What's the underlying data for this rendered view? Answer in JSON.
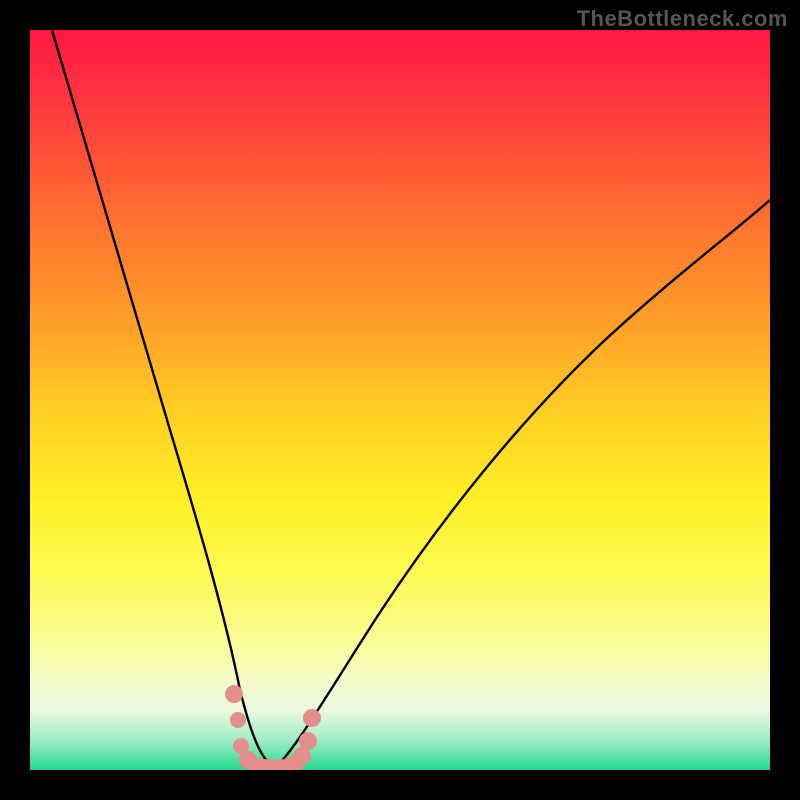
{
  "watermark": "TheBottleneck.com",
  "chart_data": {
    "type": "line",
    "title": "",
    "xlabel": "",
    "ylabel": "",
    "xlim": [
      0,
      100
    ],
    "ylim": [
      0,
      100
    ],
    "grid": false,
    "legend": false,
    "series": [
      {
        "name": "left-curve",
        "x": [
          3,
          6,
          10,
          14,
          18,
          22,
          25,
          27,
          28,
          29,
          30,
          31,
          32,
          33
        ],
        "y": [
          100,
          85,
          66,
          50,
          36,
          24,
          15,
          9,
          6,
          4,
          2.5,
          1.5,
          0.8,
          0.2
        ],
        "color": "#000000"
      },
      {
        "name": "right-curve",
        "x": [
          33,
          36,
          40,
          46,
          54,
          62,
          70,
          78,
          86,
          94,
          100
        ],
        "y": [
          0.2,
          3,
          9,
          18,
          30,
          42,
          52,
          61,
          68,
          74,
          78
        ],
        "color": "#000000"
      },
      {
        "name": "valley-markers",
        "type": "scatter",
        "x": [
          27.5,
          28,
          28.5,
          29.5,
          30.5,
          31.5,
          32.5,
          33.5,
          34.5,
          35.5,
          36.5,
          37.5,
          37.8
        ],
        "y": [
          10,
          6,
          3,
          1.2,
          0.5,
          0.3,
          0.3,
          0.3,
          0.4,
          0.8,
          1.8,
          4,
          7
        ],
        "color": "#e38e8a",
        "size": 10
      }
    ],
    "background_gradient_stops": [
      {
        "pos": 0.0,
        "color": "#ff1744"
      },
      {
        "pos": 0.08,
        "color": "#ff3141"
      },
      {
        "pos": 0.18,
        "color": "#ff5436"
      },
      {
        "pos": 0.28,
        "color": "#ff7a2f"
      },
      {
        "pos": 0.4,
        "color": "#ffa028"
      },
      {
        "pos": 0.52,
        "color": "#ffd024"
      },
      {
        "pos": 0.64,
        "color": "#fff027"
      },
      {
        "pos": 0.74,
        "color": "#fdfb57"
      },
      {
        "pos": 0.82,
        "color": "#fbfc90"
      },
      {
        "pos": 0.88,
        "color": "#f5fbc8"
      },
      {
        "pos": 0.92,
        "color": "#e9f9e0"
      },
      {
        "pos": 0.96,
        "color": "#9fecc4"
      },
      {
        "pos": 1.0,
        "color": "#22d98e"
      }
    ]
  }
}
